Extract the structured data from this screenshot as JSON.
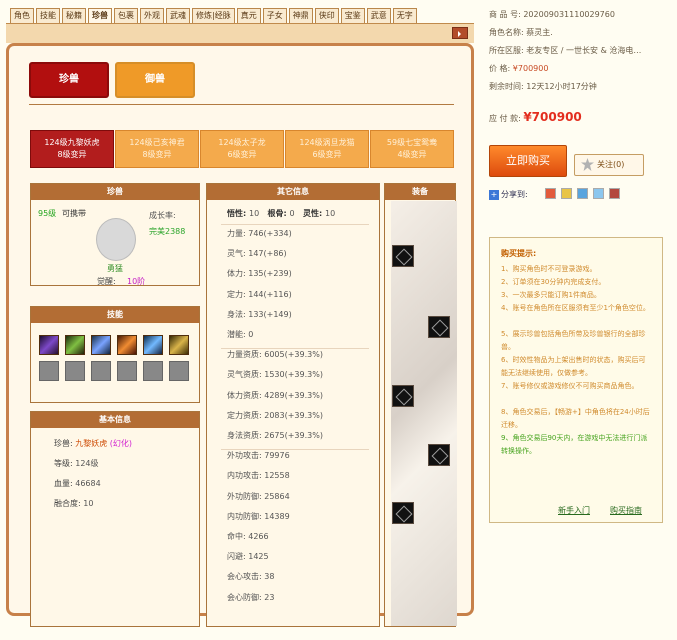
{
  "tabs": [
    "角色",
    "技能",
    "秘籍",
    "珍兽",
    "包裹",
    "外观",
    "武魂",
    "修炼|经脉",
    "真元",
    "子女",
    "神鼎",
    "侠印",
    "宝鉴",
    "武意",
    "无字"
  ],
  "active_tab": 3,
  "pet_types": {
    "active": "珍兽",
    "inactive": "御兽"
  },
  "pet_cards": [
    {
      "line1": "124级九黎妖虎",
      "line2": "8级变异"
    },
    {
      "line1": "124级己亥神君",
      "line2": "8级变异"
    },
    {
      "line1": "124级太子龙",
      "line2": "6级变异"
    },
    {
      "line1": "124级涡旦龙猫",
      "line2": "6级变异"
    },
    {
      "line1": "59级七宝鸳鸯",
      "line2": "4级变异"
    }
  ],
  "pet_panel": {
    "title": "珍兽",
    "level": "95级",
    "pet_name": "可携带",
    "growth_label": "成长率:",
    "growth_value": "完美2388",
    "nickname": "勇猛",
    "awake_label": "觉醒:",
    "awake_value": "10阶"
  },
  "skill_panel": {
    "title": "技能"
  },
  "basic_panel": {
    "title": "基本信息",
    "pet_label": "珍兽:",
    "pet_name": "九黎妖虎",
    "pet_tag": "(幻化)",
    "level_label": "等级:",
    "level_value": "124级",
    "hp_label": "血量:",
    "hp_value": "46684",
    "fusion_label": "融合度:",
    "fusion_value": "10"
  },
  "other_panel": {
    "title": "其它信息",
    "head": {
      "wuxing_label": "悟性:",
      "wuxing": "10",
      "genu_label": "根骨:",
      "genu": "0",
      "lingxing_label": "灵性:",
      "lingxing": "10"
    },
    "rows": [
      {
        "label": "力量:",
        "value": "746(+334)"
      },
      {
        "label": "灵气:",
        "value": "147(+86)"
      },
      {
        "label": "体力:",
        "value": "135(+239)"
      },
      {
        "label": "定力:",
        "value": "144(+116)"
      },
      {
        "label": "身法:",
        "value": "133(+149)"
      },
      {
        "label": "潜能:",
        "value": "0"
      },
      {
        "label": "力量资质:",
        "value": "6005(+39.3%)"
      },
      {
        "label": "灵气资质:",
        "value": "1530(+39.3%)"
      },
      {
        "label": "体力资质:",
        "value": "4289(+39.3%)"
      },
      {
        "label": "定力资质:",
        "value": "2083(+39.3%)"
      },
      {
        "label": "身法资质:",
        "value": "2675(+39.3%)"
      },
      {
        "label": "外功攻击:",
        "value": "79976"
      },
      {
        "label": "内功攻击:",
        "value": "12558"
      },
      {
        "label": "外功防御:",
        "value": "25864"
      },
      {
        "label": "内功防御:",
        "value": "14389"
      },
      {
        "label": "命中:",
        "value": "4266"
      },
      {
        "label": "闪避:",
        "value": "1425"
      },
      {
        "label": "会心攻击:",
        "value": "38"
      },
      {
        "label": "会心防御:",
        "value": "23"
      }
    ]
  },
  "equip_panel": {
    "title": "装备"
  },
  "goods": {
    "id_label": "商 品 号:",
    "id_value": "202009031110029760",
    "role_label": "角色名称:",
    "role_value": "蔡灵主.",
    "server_label": "所在区服:",
    "server_value": "老友专区 / 一世长安 & 沧海电…",
    "price_label": "价 格:",
    "price_value": "¥700900",
    "time_label": "剩余时间:",
    "time_value": "12天12小时17分钟"
  },
  "pay": {
    "label": "应 付 款:",
    "value": "¥700900"
  },
  "buttons": {
    "buy": "立即购买",
    "fav": "关注(0)",
    "share": "分享到:"
  },
  "tips": {
    "title": "购买提示:",
    "items": [
      "1、购买角色时不可登录游戏。",
      "2、订单须在30分钟内完成支付。",
      "3、一次最多只能订购1件商品。",
      "4、账号在角色所在区服须有至少1个角色空位。",
      "5、展示珍兽包括角色所带及珍兽银行的全部珍兽。",
      "6、时效性物品为上架出售时的状态，购买后可能无法继续使用，仅做参考。",
      "7、账号修仪或游戏修仪不可购买商品角色。",
      "8、角色交易后，【畅游+】中角色将在24小时后迁移。",
      "9、角色交易后90天内，在游戏中无法进行门派转换操作。"
    ],
    "guide": "新手入门",
    "buy_guide": "购买指南"
  }
}
